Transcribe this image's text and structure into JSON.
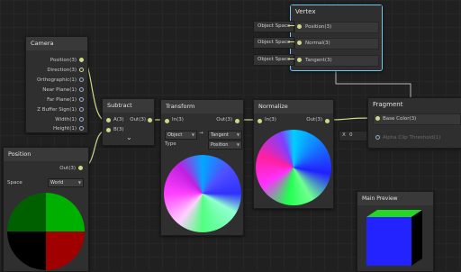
{
  "camera": {
    "title": "Camera",
    "outputs": [
      "Position(3)",
      "Direction(3)",
      "Orthographic(1)",
      "Near Plane(1)",
      "Far Plane(1)",
      "Z Buffer Sign(1)",
      "Width(1)",
      "Height(1)"
    ]
  },
  "position_node": {
    "title": "Position",
    "output": "Out(3)",
    "space_label": "Space",
    "space_value": "World"
  },
  "subtract": {
    "title": "Subtract",
    "input_a": "A(3)",
    "input_b": "B(3)",
    "output": "Out(3)",
    "chevron": "⌄"
  },
  "transform": {
    "title": "Transform",
    "input": "In(3)",
    "output": "Out(3)",
    "from_space": "Object",
    "arrow": "→",
    "to_space": "Tangent",
    "type_label": "Type",
    "type_value": "Position"
  },
  "normalize": {
    "title": "Normalize",
    "input": "In(3)",
    "output": "Out(3)"
  },
  "vertex": {
    "title": "Vertex",
    "ports": [
      "Position(3)",
      "Normal(3)",
      "Tangent(3)"
    ],
    "sources": [
      "Object Space",
      "Object Space",
      "Object Space"
    ]
  },
  "fragment": {
    "title": "Fragment",
    "ports": [
      "Base Color(3)",
      "Alpha Clip Threshold(1)"
    ],
    "alpha_input_axis": "X",
    "alpha_input_value": "0"
  },
  "main_preview": {
    "title": "Main Preview"
  },
  "colors": {
    "wire_vec": "#cfd88a",
    "wire_connector": "#b8b8b8",
    "selection": "#6fc7ee",
    "background": "#202020",
    "node_body": "#2f2f2f",
    "node_header": "#393939"
  }
}
